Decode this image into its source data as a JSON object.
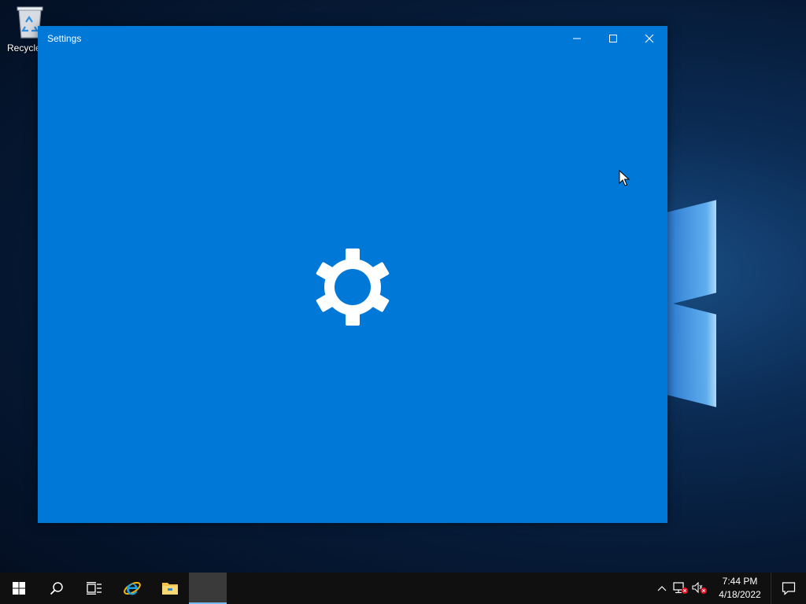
{
  "desktop": {
    "icons": [
      {
        "label": "Recycle",
        "icon": "recycle-bin-icon"
      }
    ]
  },
  "window": {
    "title": "Settings",
    "background": "#0078d7",
    "buttons": {
      "minimize": "minimize-icon",
      "maximize": "maximize-icon",
      "close": "close-icon"
    },
    "splash_icon": "gear-icon"
  },
  "taskbar": {
    "items": [
      {
        "name": "start",
        "icon": "windows-start-icon"
      },
      {
        "name": "search",
        "icon": "search-icon"
      },
      {
        "name": "task-view",
        "icon": "task-view-icon"
      },
      {
        "name": "internet-explorer",
        "icon": "internet-explorer-icon"
      },
      {
        "name": "file-explorer",
        "icon": "folder-icon"
      },
      {
        "name": "settings-app",
        "icon": "settings-app-icon",
        "active": true
      }
    ],
    "tray": {
      "icons": [
        "chevron-up-icon",
        "network-disconnected-icon",
        "volume-muted-icon"
      ],
      "time": "7:44 PM",
      "date": "4/18/2022",
      "notification_icon": "action-center-icon"
    }
  }
}
